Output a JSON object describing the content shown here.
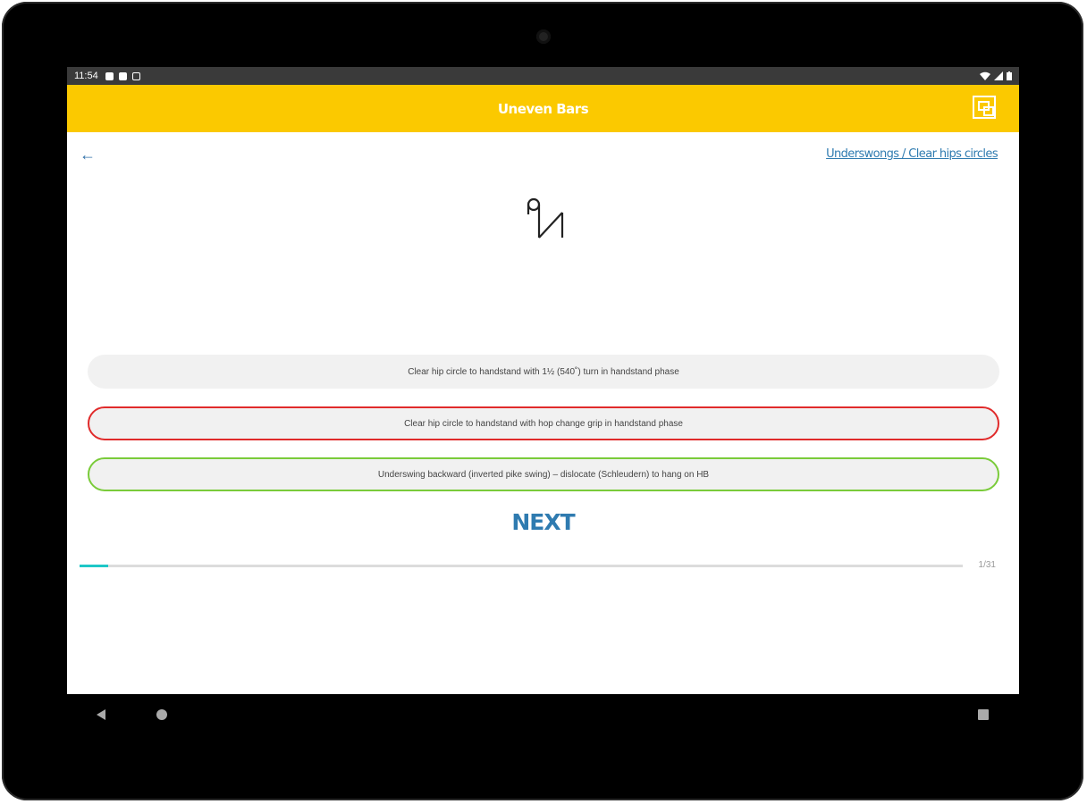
{
  "status_bar": {
    "time": "11:54",
    "left_icons": [
      "notification-icon",
      "sd-card-icon",
      "sim-icon"
    ],
    "right_icons": [
      "wifi-icon",
      "signal-icon",
      "battery-icon"
    ]
  },
  "app_bar": {
    "title": "Uneven Bars",
    "action_icon": "gallery-icon",
    "accent_color": "#fbc900"
  },
  "breadcrumb": "Underswongs / Clear hips circles",
  "symbol_icon": "skill-notation-symbol",
  "options": [
    {
      "text": "Clear hip circle to handstand with 1½ (540˚) turn in handstand phase",
      "state": "neutral"
    },
    {
      "text": "Clear hip circle to handstand with hop change grip in handstand phase",
      "state": "wrong"
    },
    {
      "text": "Underswing backward (inverted pike swing) – dislocate (Schleudern) to hang on HB",
      "state": "correct"
    }
  ],
  "next_label": "NEXT",
  "progress": {
    "current": 1,
    "total": 31,
    "label": "1/31",
    "fraction": 0.0323
  },
  "colors": {
    "wrong": "#e02b2b",
    "correct": "#7acb3a",
    "link": "#2f7bb0",
    "progress": "#1ec7c7"
  },
  "nav_bar": [
    "back-icon",
    "home-icon",
    "recents-icon"
  ]
}
